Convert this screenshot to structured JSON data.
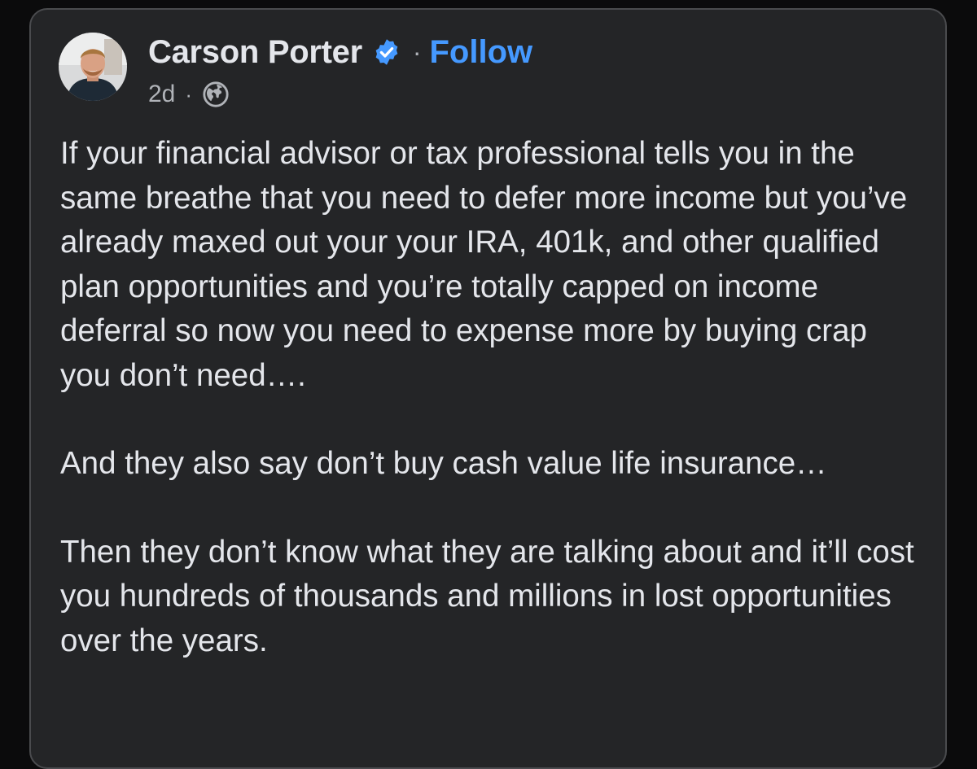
{
  "post": {
    "author": {
      "name": "Carson Porter",
      "avatar_icon": "profile-photo",
      "verified_icon": "verified-badge-icon",
      "verified_color": "#4599ff"
    },
    "separator": "·",
    "follow_label": "Follow",
    "timestamp": "2d",
    "meta_separator": "·",
    "audience_icon": "globe-icon",
    "paragraphs": [
      "If your financial advisor or tax professional tells you in the same breathe that you need to defer more income but you’ve already maxed out your your IRA, 401k, and other qualified plan opportunities and you’re totally capped on income deferral so now you need to expense more by buying crap you don’t need….",
      "And they also say don’t buy cash value life insurance…",
      "Then they don’t know what they are talking about and it’ll cost you hundreds of thousands and millions in lost opportunities over the years."
    ]
  },
  "colors": {
    "card_background": "#242527",
    "card_border": "#4a4b4e",
    "text_primary": "#e4e6eb",
    "text_secondary": "#b0b3b8",
    "link_blue": "#4599ff"
  }
}
